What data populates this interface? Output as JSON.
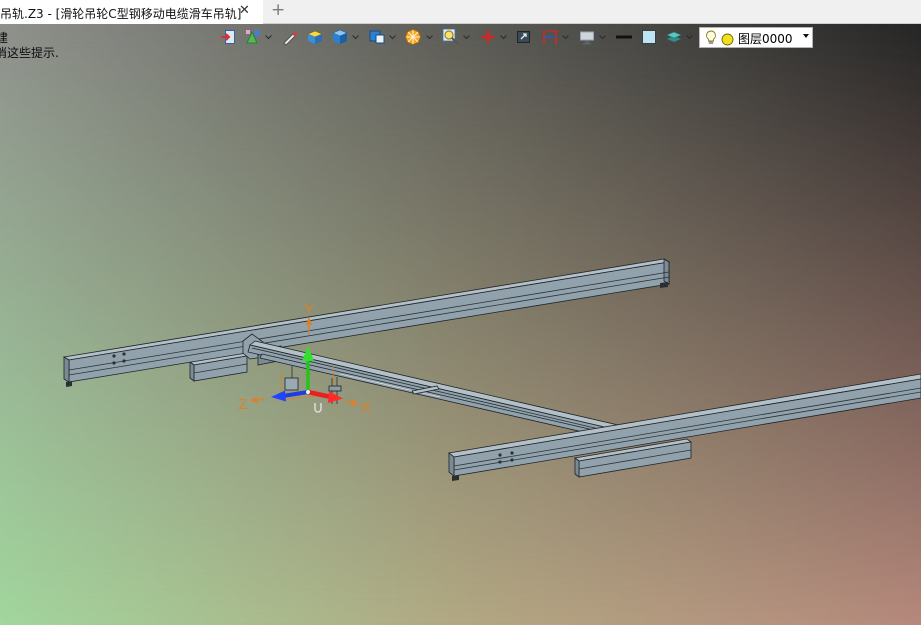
{
  "window": {
    "tab_title": "吊轨.Z3 - [滑轮吊轮C型钢移动电缆滑车吊轨]",
    "close_symbol": "✕",
    "new_tab_symbol": "+"
  },
  "hint": {
    "line1": "建",
    "line2": "消这些提示."
  },
  "toolbar": {
    "icons": [
      "exit-icon",
      "sketch-icon",
      "brush-icon",
      "shaded-cube-icon",
      "cube-icon",
      "box-view-icon",
      "render-icon",
      "zoom-icon",
      "crosshair-icon",
      "fit-view-icon",
      "dimension-icon",
      "monitor-icon",
      "line-weight-icon",
      "color-swatch-icon",
      "layer-stack-icon"
    ],
    "layer": {
      "name": "图层0000",
      "bulb_icon": "light-bulb-icon",
      "status_color": "#f2e01b"
    }
  },
  "viewport": {
    "axes": {
      "x": "X",
      "y": "Y",
      "z": "Z"
    },
    "axis_colors": {
      "x": "#e8201f",
      "y": "#22c41f",
      "z": "#1f3de0",
      "label": "#d9822b"
    },
    "background": {
      "top_left": "#8f918c",
      "top_right": "#262626",
      "bottom_left": "#a1d69d",
      "bottom_right": "#b6897c"
    },
    "model_color": "#b3c0c7"
  }
}
